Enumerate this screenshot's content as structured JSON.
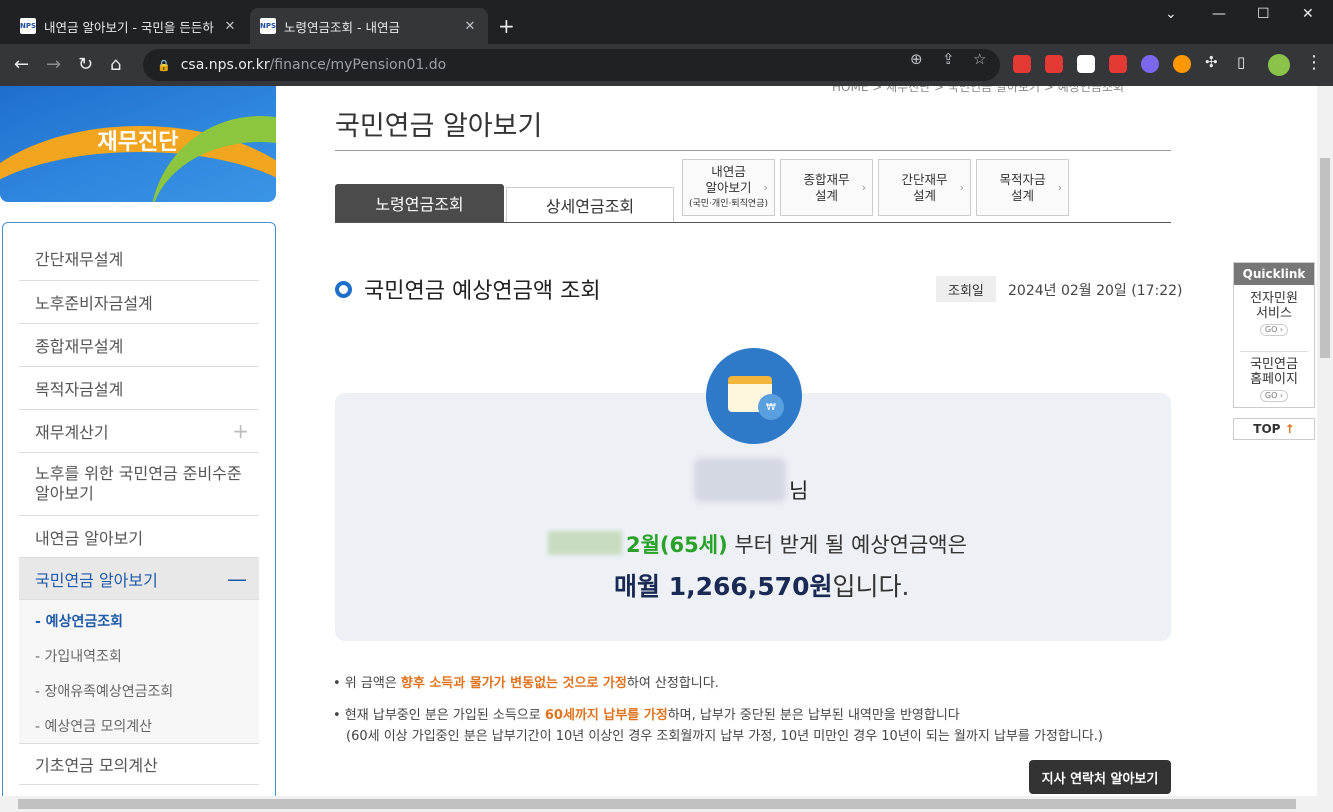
{
  "browser": {
    "tabs": [
      {
        "title": "내연금 알아보기 - 국민을 든든하",
        "active": false
      },
      {
        "title": "노령연금조회 - 내연금",
        "active": true
      }
    ],
    "url_host": "csa.nps.or.kr",
    "url_path": "/finance/myPension01.do",
    "extension_colors": [
      "#e53935",
      "#e53935",
      "#ffffff",
      "#e53935",
      "#7b68ee",
      "#ff9800"
    ]
  },
  "breadcrumb": "HOME > 재무진단 > 국민연금 알아보기 > 예상연금조회",
  "banner": {
    "title": "재무진단"
  },
  "sidebar": {
    "items": [
      {
        "label": "간단재무설계"
      },
      {
        "label": "노후준비자금설계"
      },
      {
        "label": "종합재무설계"
      },
      {
        "label": "목적자금설계"
      },
      {
        "label": "재무계산기"
      },
      {
        "label": "노후를 위한 국민연금 준비수준 알아보기"
      },
      {
        "label": "내연금 알아보기"
      },
      {
        "label": "국민연금 알아보기"
      },
      {
        "label": "기초연금 모의계산"
      }
    ],
    "sub_items": [
      {
        "label": "- 예상연금조회"
      },
      {
        "label": "- 가입내역조회"
      },
      {
        "label": "- 장애유족예상연금조회"
      },
      {
        "label": "- 예상연금 모의계산"
      }
    ]
  },
  "main": {
    "page_title": "국민연금 알아보기",
    "tabs": [
      {
        "label": "노령연금조회"
      },
      {
        "label": "상세연금조회"
      }
    ],
    "link_boxes": [
      {
        "line1": "내연금",
        "line2": "알아보기",
        "small": "(국민·개인·퇴직연금)"
      },
      {
        "line1": "종합재무",
        "line2": "설계"
      },
      {
        "line1": "간단재무",
        "line2": "설계"
      },
      {
        "line1": "목적자금",
        "line2": "설계"
      }
    ],
    "section_title": "국민연금 예상연금액 조회",
    "date_label": "조회일",
    "date_value": "2024년 02월 20일 (17:22)",
    "honorific": "님",
    "start_month": "2월(65세)",
    "line2_rest": "부터 받게 될 예상연금액은",
    "amount": "매월 1,266,570원",
    "amount_suffix": "입니다.",
    "note1_pre": "• 위 금액은 ",
    "note1_em": "향후 소득과 물가가 변동없는 것으로 가정",
    "note1_post": "하여 산정합니다.",
    "note2_pre": "• 현재 납부중인 분은 가입된 소득으로 ",
    "note2_em": "60세까지 납부를 가정",
    "note2_post": "하며, 납부가 중단된 분은 납부된 내역만을 반영합니다",
    "note3": "(60세 이상 가입중인 분은 납부기간이 10년 이상인 경우 조회월까지 납부 가정, 10년 미만인 경우 10년이 되는 월까지 납부를 가정합니다.)",
    "branch_button": "지사 연락처 알아보기"
  },
  "quicklink": {
    "title": "Quicklink",
    "items": [
      {
        "line1": "전자민원",
        "line2": "서비스",
        "go": "GO ›"
      },
      {
        "line1": "국민연금",
        "line2": "홈페이지",
        "go": "GO ›"
      }
    ],
    "top_label": "TOP",
    "top_arrow": "↑"
  }
}
